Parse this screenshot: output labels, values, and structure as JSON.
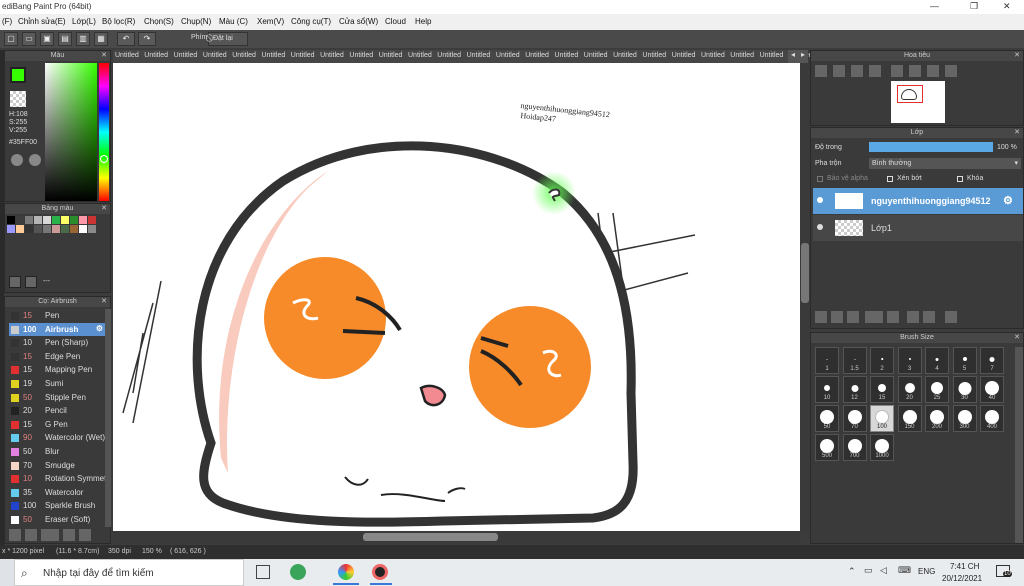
{
  "window": {
    "title": "ediBang Paint Pro (64bit)",
    "controls": [
      "—",
      "❐",
      "✕"
    ]
  },
  "menu": [
    "(F)",
    "Chỉnh sửa(E)",
    "Lớp(L)",
    "Bộ lọc(R)",
    "Chọn(S)",
    "Chụp(N)",
    "Màu (C)",
    "Xem(V)",
    "Công cụ(T)",
    "Cửa sổ(W)",
    "Cloud",
    "Help"
  ],
  "toolbar": {
    "phim_label": "Phím",
    "reset_label": "Đặt lại"
  },
  "doc_tabs": [
    "Untitled",
    "Untitled",
    "Untitled",
    "Untitled",
    "Untitled",
    "Untitled",
    "Untitled",
    "Untitled",
    "Untitled",
    "Untitled",
    "Untitled",
    "Untitled",
    "Untitled",
    "Untitled",
    "Untitled",
    "Untitled",
    "Untitled",
    "Untitled",
    "Untitled",
    "Untitled",
    "Untitled",
    "Untitled",
    "Untitled",
    "Untitled"
  ],
  "color_panel": {
    "title": "Màu",
    "h": "H:108",
    "s": "S:255",
    "v": "V:255",
    "hex": "#35FF00",
    "current_color": "#35FF00"
  },
  "palette_panel": {
    "title": "Bảng màu",
    "swatches": [
      "#000000",
      "#3d3d3d",
      "#7a7a7a",
      "#b5b5b5",
      "#d8d8d8",
      "#2ab34a",
      "#ffff66",
      "#2a8c2a",
      "#ff99aa",
      "#cc3333",
      "#9999ff",
      "#ffcc99",
      "#333333",
      "#555555",
      "#777777",
      "#cc9999",
      "#4a6a4a",
      "#996633",
      "#ffffff",
      "#8a8a8a"
    ],
    "footer_text": "---"
  },
  "brush_panel": {
    "title": "Cọ: Airbrush",
    "items": [
      {
        "size": "15",
        "name": "Pen",
        "color": "#333333"
      },
      {
        "size": "100",
        "name": "Airbrush",
        "color": "#cccccc",
        "selected": true
      },
      {
        "size": "10",
        "name": "Pen (Sharp)",
        "color": "#333333"
      },
      {
        "size": "15",
        "name": "Edge Pen",
        "color": "#333333"
      },
      {
        "size": "15",
        "name": "Mapping Pen",
        "color": "#e03030"
      },
      {
        "size": "19",
        "name": "Sumi",
        "color": "#e0d020"
      },
      {
        "size": "50",
        "name": "Stipple Pen",
        "color": "#e0d020"
      },
      {
        "size": "20",
        "name": "Pencil",
        "color": "#222222"
      },
      {
        "size": "15",
        "name": "G Pen",
        "color": "#e03030"
      },
      {
        "size": "90",
        "name": "Watercolor (Wet)",
        "color": "#66ccee"
      },
      {
        "size": "50",
        "name": "Blur",
        "color": "#e080e0"
      },
      {
        "size": "70",
        "name": "Smudge",
        "color": "#f5d5c5"
      },
      {
        "size": "10",
        "name": "Rotation Symmetry",
        "color": "#e03030"
      },
      {
        "size": "35",
        "name": "Watercolor",
        "color": "#66ccee"
      },
      {
        "size": "100",
        "name": "Sparkle Brush",
        "color": "#2244cc"
      },
      {
        "size": "50",
        "name": "Eraser (Soft)",
        "color": "#ffffff"
      }
    ]
  },
  "canvas_text": {
    "watermark1": "nguyenthihuonggiang94512",
    "watermark2": "Hoidap247"
  },
  "navigator": {
    "title": "Hoa tiêu"
  },
  "layer_panel": {
    "title": "Lớp",
    "opacity_label": "Độ trong",
    "opacity_value": "100 %",
    "opacity_fraction": 1.0,
    "blend_label": "Pha trộn",
    "blend_value": "Bình thường",
    "protect_alpha": "Bảo vệ alpha",
    "clipping": "Xén bớt",
    "lock": "Khóa",
    "layers": [
      {
        "name": "nguyenthihuonggiang94512",
        "selected": true
      },
      {
        "name": "Lớp1",
        "selected": false
      }
    ]
  },
  "brush_size_panel": {
    "title": "Brush Size",
    "sizes": [
      "1",
      "1.5",
      "2",
      "3",
      "4",
      "5",
      "7",
      "10",
      "12",
      "15",
      "20",
      "25",
      "30",
      "40",
      "50",
      "70",
      "100",
      "150",
      "200",
      "300",
      "400",
      "500",
      "700",
      "1000"
    ],
    "selected": "100"
  },
  "status": {
    "dims": "x * 1200 pixel",
    "cm": "(11.6 * 8.7cm)",
    "dpi": "350 dpi",
    "zoom": "150 %",
    "coords": "( 616, 626 )"
  },
  "taskbar": {
    "search_placeholder": "Nhập tại đây để tìm kiếm",
    "lang": "ENG",
    "time": "7:41 CH",
    "date": "20/12/2021",
    "notif_count": "10"
  }
}
